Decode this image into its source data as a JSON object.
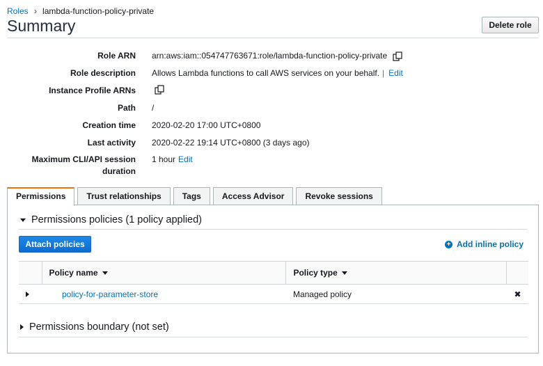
{
  "breadcrumb": {
    "root": "Roles",
    "current": "lambda-function-policy-private"
  },
  "page_title": "Summary",
  "delete_button": "Delete role",
  "summary": {
    "role_arn": {
      "label": "Role ARN",
      "value": "arn:aws:iam::054747763671:role/lambda-function-policy-private"
    },
    "role_description": {
      "label": "Role description",
      "value": "Allows Lambda functions to call AWS services on your behalf.",
      "separator": "|",
      "edit": "Edit"
    },
    "instance_profile": {
      "label": "Instance Profile ARNs"
    },
    "path": {
      "label": "Path",
      "value": "/"
    },
    "creation_time": {
      "label": "Creation time",
      "value": "2020-02-20 17:00 UTC+0800"
    },
    "last_activity": {
      "label": "Last activity",
      "value": "2020-02-22 19:14 UTC+0800 (3 days ago)"
    },
    "max_session": {
      "label_line1": "Maximum CLI/API session",
      "label_line2": "duration",
      "value": "1 hour",
      "edit": "Edit"
    }
  },
  "tabs": [
    {
      "label": "Permissions",
      "active": true
    },
    {
      "label": "Trust relationships",
      "active": false
    },
    {
      "label": "Tags",
      "active": false
    },
    {
      "label": "Access Advisor",
      "active": false
    },
    {
      "label": "Revoke sessions",
      "active": false
    }
  ],
  "permissions": {
    "heading": "Permissions policies (1 policy applied)",
    "attach_button": "Attach policies",
    "add_inline": "Add inline policy",
    "table": {
      "columns": [
        "Policy name",
        "Policy type"
      ],
      "rows": [
        {
          "name": "policy-for-parameter-store",
          "type": "Managed policy"
        }
      ]
    },
    "boundary_heading": "Permissions boundary (not set)"
  },
  "colors": {
    "link": "#0073bb",
    "primary_button": "#0b6cd0",
    "active_tab_accent": "#ec7211",
    "border": "#aab7b8"
  },
  "icons": [
    "copy-icon",
    "plus-circle-icon",
    "caret-down-icon",
    "caret-right-icon",
    "remove-x-icon"
  ]
}
